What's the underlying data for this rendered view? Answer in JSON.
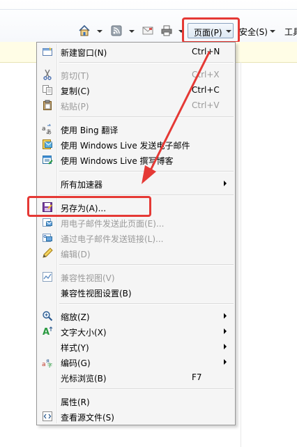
{
  "toolbar": {
    "page_label": "页面(P)",
    "safety_label": "安全(S)",
    "tools_label": "工具"
  },
  "menu": {
    "items": [
      {
        "label": "新建窗口(N)",
        "shortcut": "Ctrl+N",
        "disabled": false,
        "icon": "new-window-icon"
      },
      {
        "label": "剪切(T)",
        "shortcut": "Ctrl+X",
        "disabled": true,
        "icon": "scissors-icon"
      },
      {
        "label": "复制(C)",
        "shortcut": "Ctrl+C",
        "disabled": false,
        "icon": "copy-icon"
      },
      {
        "label": "粘贴(P)",
        "shortcut": "Ctrl+V",
        "disabled": true,
        "icon": "paste-icon"
      },
      {
        "label": "使用 Bing 翻译",
        "shortcut": "",
        "disabled": false,
        "icon": "translate-icon"
      },
      {
        "label": "使用 Windows Live 发送电子邮件",
        "shortcut": "",
        "disabled": false,
        "icon": "email-live-icon"
      },
      {
        "label": "使用 Windows Live 撰写博客",
        "shortcut": "",
        "disabled": false,
        "icon": "blog-icon"
      },
      {
        "label": "所有加速器",
        "shortcut": "",
        "disabled": false,
        "icon": "",
        "submenu": true
      },
      {
        "label": "另存为(A)...",
        "shortcut": "",
        "disabled": false,
        "icon": "save-as-icon"
      },
      {
        "label": "用电子邮件发送此页面(E)...",
        "shortcut": "",
        "disabled": true,
        "icon": "email-page-icon"
      },
      {
        "label": "通过电子邮件发送链接(L)...",
        "shortcut": "",
        "disabled": true,
        "icon": "email-link-icon"
      },
      {
        "label": "编辑(D)",
        "shortcut": "",
        "disabled": true,
        "icon": "pencil-icon"
      },
      {
        "label": "兼容性视图(V)",
        "shortcut": "",
        "disabled": true,
        "icon": "compat-view-icon"
      },
      {
        "label": "兼容性视图设置(B)",
        "shortcut": "",
        "disabled": false,
        "icon": ""
      },
      {
        "label": "缩放(Z)",
        "shortcut": "",
        "disabled": false,
        "icon": "zoom-icon",
        "submenu": true
      },
      {
        "label": "文字大小(X)",
        "shortcut": "",
        "disabled": false,
        "icon": "text-size-icon",
        "submenu": true
      },
      {
        "label": "样式(Y)",
        "shortcut": "",
        "disabled": false,
        "icon": "",
        "submenu": true
      },
      {
        "label": "编码(G)",
        "shortcut": "",
        "disabled": false,
        "icon": "encoding-icon",
        "submenu": true
      },
      {
        "label": "光标浏览(B)",
        "shortcut": "F7",
        "disabled": false,
        "icon": ""
      },
      {
        "label": "属性(R)",
        "shortcut": "",
        "disabled": false,
        "icon": ""
      },
      {
        "label": "查看源文件(S)",
        "shortcut": "",
        "disabled": false,
        "icon": "view-source-icon"
      }
    ]
  },
  "colors": {
    "highlight": "#e53935",
    "menu_bg": "#f5f5f5",
    "disabled_text": "#9a9a9a",
    "infobar": "#fffde6"
  }
}
